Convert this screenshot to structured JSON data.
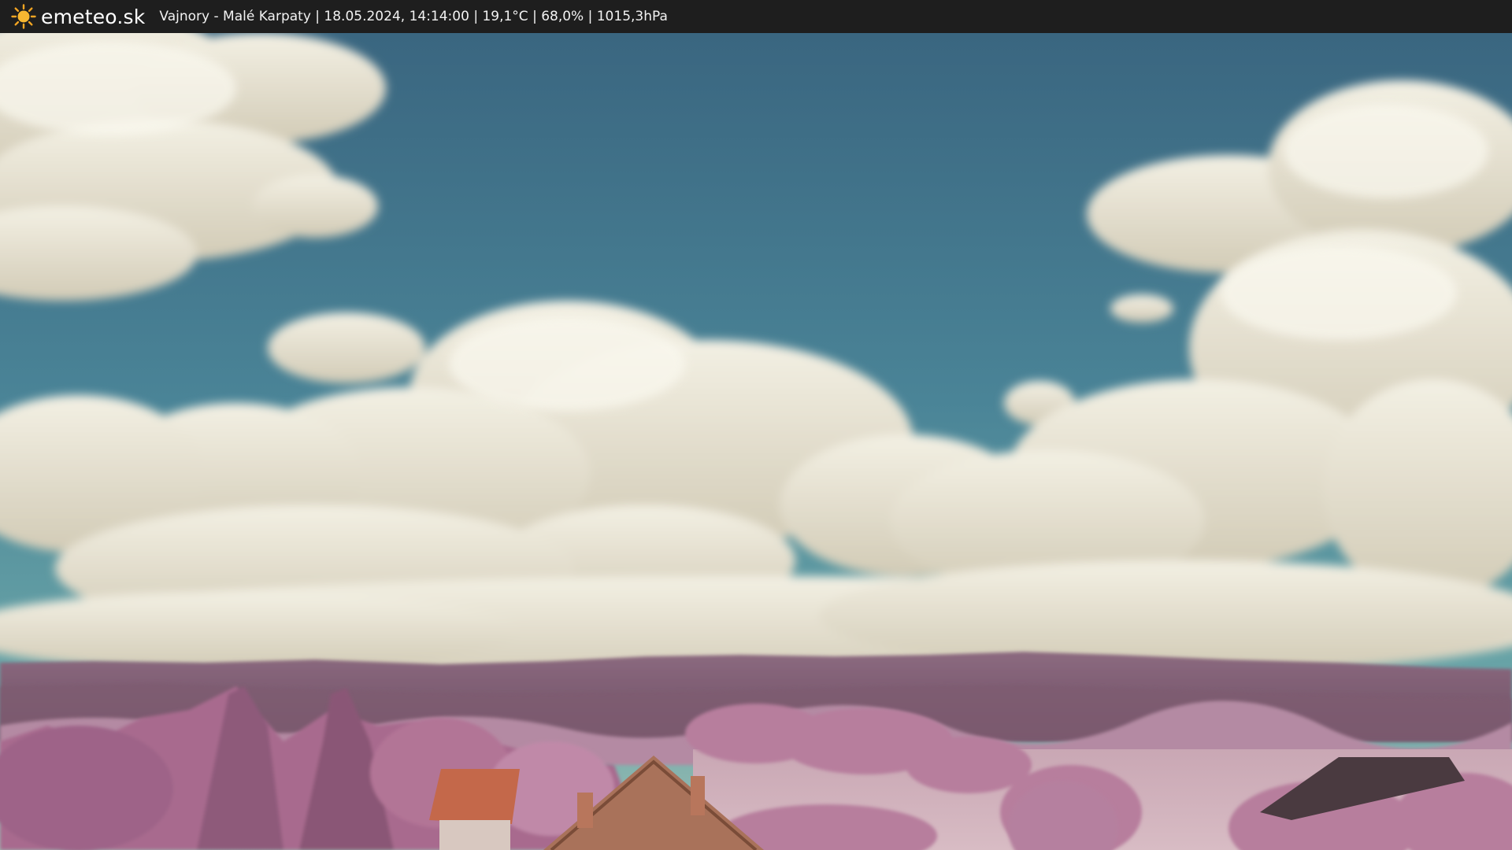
{
  "header": {
    "brand": "emeteo.sk",
    "info": "Vajnory - Malé Karpaty | 18.05.2024, 14:14:00 | 19,1°C | 68,0% | 1015,3hPa",
    "logo_icon": "sun-icon"
  },
  "webcam": {
    "description_icon": "webcam-image",
    "colors": {
      "sky_top": "#3b6a82",
      "sky_bottom": "#5a9aa6",
      "cloud": "#e8e4d6",
      "hills": "#7a5a6e",
      "foliage": "#b06f96",
      "roof": "#b55a3c"
    }
  }
}
